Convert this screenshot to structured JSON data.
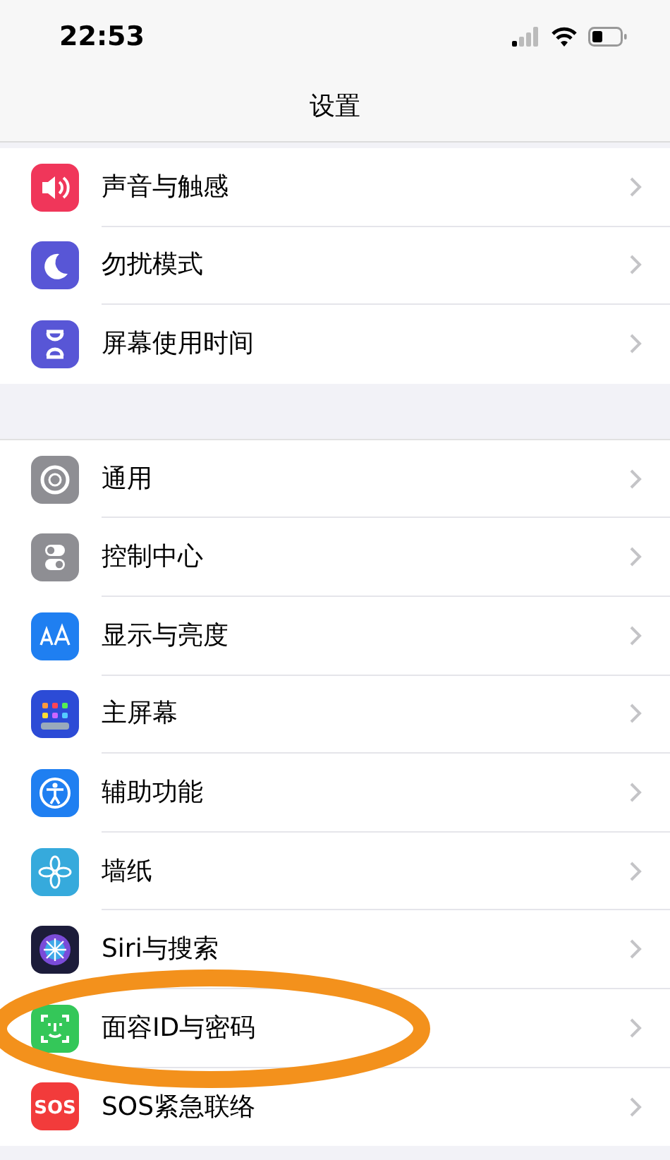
{
  "status_bar": {
    "time": "22:53"
  },
  "nav": {
    "title": "设置"
  },
  "groups": [
    {
      "items": [
        {
          "label": "声音与触感"
        },
        {
          "label": "勿扰模式"
        },
        {
          "label": "屏幕使用时间"
        }
      ]
    },
    {
      "items": [
        {
          "label": "通用"
        },
        {
          "label": "控制中心"
        },
        {
          "label": "显示与亮度"
        },
        {
          "label": "主屏幕"
        },
        {
          "label": "辅助功能"
        },
        {
          "label": "墙纸"
        },
        {
          "label": "Siri与搜索"
        },
        {
          "label": "面容ID与密码"
        },
        {
          "label": "SOS紧急联络",
          "icon_label": "SOS"
        }
      ]
    }
  ],
  "annotation": {
    "kind": "ellipse",
    "color": "#f3911c"
  }
}
